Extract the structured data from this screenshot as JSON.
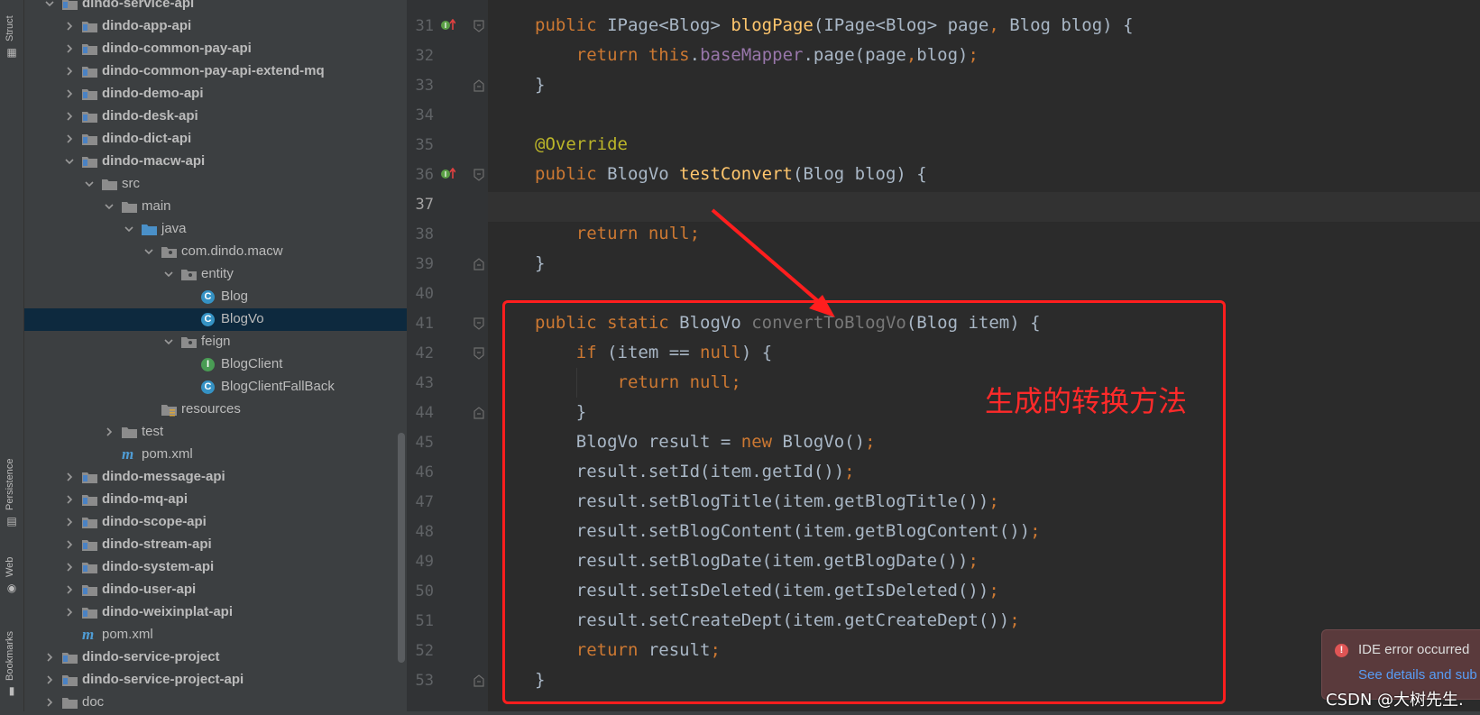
{
  "sidebar": {
    "tabs": [
      {
        "label": "Struct",
        "icon": "structure-icon"
      },
      {
        "label": "Persistence",
        "icon": "persistence-icon"
      },
      {
        "label": "Web",
        "icon": "web-icon"
      },
      {
        "label": "Bookmarks",
        "icon": "bookmark-icon"
      }
    ]
  },
  "tree": {
    "items": [
      {
        "label": "dindo-service-api",
        "bold": true,
        "icon": "module-folder-icon",
        "expanded": true
      },
      {
        "label": "dindo-app-api",
        "bold": true,
        "icon": "module-folder-icon",
        "expanded": false
      },
      {
        "label": "dindo-common-pay-api",
        "bold": true,
        "icon": "module-folder-icon",
        "expanded": false
      },
      {
        "label": "dindo-common-pay-api-extend-mq",
        "bold": true,
        "icon": "module-folder-icon",
        "expanded": false
      },
      {
        "label": "dindo-demo-api",
        "bold": true,
        "icon": "module-folder-icon",
        "expanded": false
      },
      {
        "label": "dindo-desk-api",
        "bold": true,
        "icon": "module-folder-icon",
        "expanded": false
      },
      {
        "label": "dindo-dict-api",
        "bold": true,
        "icon": "module-folder-icon",
        "expanded": false
      },
      {
        "label": "dindo-macw-api",
        "bold": true,
        "icon": "module-folder-icon",
        "expanded": true
      },
      {
        "label": "src",
        "bold": false,
        "icon": "folder-icon",
        "expanded": true
      },
      {
        "label": "main",
        "bold": false,
        "icon": "folder-icon",
        "expanded": true
      },
      {
        "label": "java",
        "bold": false,
        "icon": "source-folder-icon",
        "expanded": true
      },
      {
        "label": "com.dindo.macw",
        "bold": false,
        "icon": "package-icon",
        "expanded": true
      },
      {
        "label": "entity",
        "bold": false,
        "icon": "package-icon",
        "expanded": true
      },
      {
        "label": "Blog",
        "bold": false,
        "icon": "class-icon"
      },
      {
        "label": "BlogVo",
        "bold": false,
        "icon": "class-icon",
        "selected": true
      },
      {
        "label": "feign",
        "bold": false,
        "icon": "package-icon",
        "expanded": true
      },
      {
        "label": "BlogClient",
        "bold": false,
        "icon": "interface-icon"
      },
      {
        "label": "BlogClientFallBack",
        "bold": false,
        "icon": "class-icon"
      },
      {
        "label": "resources",
        "bold": false,
        "icon": "resources-folder-icon"
      },
      {
        "label": "test",
        "bold": false,
        "icon": "folder-icon",
        "expanded": false
      },
      {
        "label": "pom.xml",
        "bold": false,
        "icon": "maven-icon"
      },
      {
        "label": "dindo-message-api",
        "bold": true,
        "icon": "module-folder-icon",
        "expanded": false
      },
      {
        "label": "dindo-mq-api",
        "bold": true,
        "icon": "module-folder-icon",
        "expanded": false
      },
      {
        "label": "dindo-scope-api",
        "bold": true,
        "icon": "module-folder-icon",
        "expanded": false
      },
      {
        "label": "dindo-stream-api",
        "bold": true,
        "icon": "module-folder-icon",
        "expanded": false
      },
      {
        "label": "dindo-system-api",
        "bold": true,
        "icon": "module-folder-icon",
        "expanded": false
      },
      {
        "label": "dindo-user-api",
        "bold": true,
        "icon": "module-folder-icon",
        "expanded": false
      },
      {
        "label": "dindo-weixinplat-api",
        "bold": true,
        "icon": "module-folder-icon",
        "expanded": false
      },
      {
        "label": "pom.xml",
        "bold": false,
        "icon": "maven-icon"
      },
      {
        "label": "dindo-service-project",
        "bold": true,
        "icon": "module-folder-icon",
        "expanded": false
      },
      {
        "label": "dindo-service-project-api",
        "bold": true,
        "icon": "module-folder-icon",
        "expanded": false
      },
      {
        "label": "doc",
        "bold": false,
        "icon": "folder-icon",
        "expanded": false
      }
    ]
  },
  "editor": {
    "current_line": "37",
    "lines": [
      {
        "num": "31",
        "marker": "implements-icon",
        "tokens": [
          [
            "kw",
            "public "
          ],
          [
            "p",
            "IPage<Blog> "
          ],
          [
            "fn",
            "blogPage"
          ],
          [
            "p",
            "(IPage<Blog> page"
          ],
          [
            "kw",
            ", "
          ],
          [
            "p",
            "Blog blog) {"
          ]
        ]
      },
      {
        "num": "32",
        "tokens": [
          [
            "p",
            "    "
          ],
          [
            "kw",
            "return this"
          ],
          [
            "p",
            "."
          ],
          [
            "fld",
            "baseMapper"
          ],
          [
            "p",
            ".page(page"
          ],
          [
            "kw",
            ","
          ],
          [
            "p",
            "blog)"
          ],
          [
            "kw",
            ";"
          ]
        ]
      },
      {
        "num": "33",
        "tokens": [
          [
            "p",
            "}"
          ]
        ]
      },
      {
        "num": "34",
        "tokens": []
      },
      {
        "num": "35",
        "tokens": [
          [
            "an",
            "@Override"
          ]
        ]
      },
      {
        "num": "36",
        "marker": "implements-icon",
        "tokens": [
          [
            "kw",
            "public "
          ],
          [
            "p",
            "BlogVo "
          ],
          [
            "fn",
            "testConvert"
          ],
          [
            "p",
            "(Blog blog) {"
          ]
        ]
      },
      {
        "num": "37",
        "tokens": []
      },
      {
        "num": "38",
        "tokens": [
          [
            "p",
            "    "
          ],
          [
            "kw",
            "return null;"
          ]
        ]
      },
      {
        "num": "39",
        "tokens": [
          [
            "p",
            "}"
          ]
        ]
      },
      {
        "num": "40",
        "tokens": []
      },
      {
        "num": "41",
        "tokens": [
          [
            "kw",
            "public static "
          ],
          [
            "p",
            "BlogVo "
          ],
          [
            "unused",
            "convertToBlogVo"
          ],
          [
            "p",
            "(Blog item) {"
          ]
        ]
      },
      {
        "num": "42",
        "tokens": [
          [
            "p",
            "    "
          ],
          [
            "kw",
            "if "
          ],
          [
            "p",
            "(item == "
          ],
          [
            "kw",
            "null"
          ],
          [
            "p",
            ") {"
          ]
        ]
      },
      {
        "num": "43",
        "tokens": [
          [
            "p",
            "        "
          ],
          [
            "kw",
            "return null;"
          ]
        ]
      },
      {
        "num": "44",
        "tokens": [
          [
            "p",
            "    }"
          ]
        ]
      },
      {
        "num": "45",
        "tokens": [
          [
            "p",
            "    BlogVo result = "
          ],
          [
            "kw",
            "new "
          ],
          [
            "p",
            "BlogVo()"
          ],
          [
            "kw",
            ";"
          ]
        ]
      },
      {
        "num": "46",
        "tokens": [
          [
            "p",
            "    result.setId(item.getId())"
          ],
          [
            "kw",
            ";"
          ]
        ]
      },
      {
        "num": "47",
        "tokens": [
          [
            "p",
            "    result.setBlogTitle(item.getBlogTitle())"
          ],
          [
            "kw",
            ";"
          ]
        ]
      },
      {
        "num": "48",
        "tokens": [
          [
            "p",
            "    result.setBlogContent(item.getBlogContent())"
          ],
          [
            "kw",
            ";"
          ]
        ]
      },
      {
        "num": "49",
        "tokens": [
          [
            "p",
            "    result.setBlogDate(item.getBlogDate())"
          ],
          [
            "kw",
            ";"
          ]
        ]
      },
      {
        "num": "50",
        "tokens": [
          [
            "p",
            "    result.setIsDeleted(item.getIsDeleted())"
          ],
          [
            "kw",
            ";"
          ]
        ]
      },
      {
        "num": "51",
        "tokens": [
          [
            "p",
            "    result.setCreateDept(item.getCreateDept())"
          ],
          [
            "kw",
            ";"
          ]
        ]
      },
      {
        "num": "52",
        "tokens": [
          [
            "p",
            "    "
          ],
          [
            "kw",
            "return "
          ],
          [
            "p",
            "result"
          ],
          [
            "kw",
            ";"
          ]
        ]
      },
      {
        "num": "53",
        "tokens": [
          [
            "p",
            "}"
          ]
        ]
      }
    ]
  },
  "annotation": {
    "text": "生成的转换方法",
    "color": "#ff2a2a"
  },
  "notification": {
    "title": "IDE error occurred",
    "link": "See details and sub"
  },
  "watermark": "CSDN @大树先生."
}
